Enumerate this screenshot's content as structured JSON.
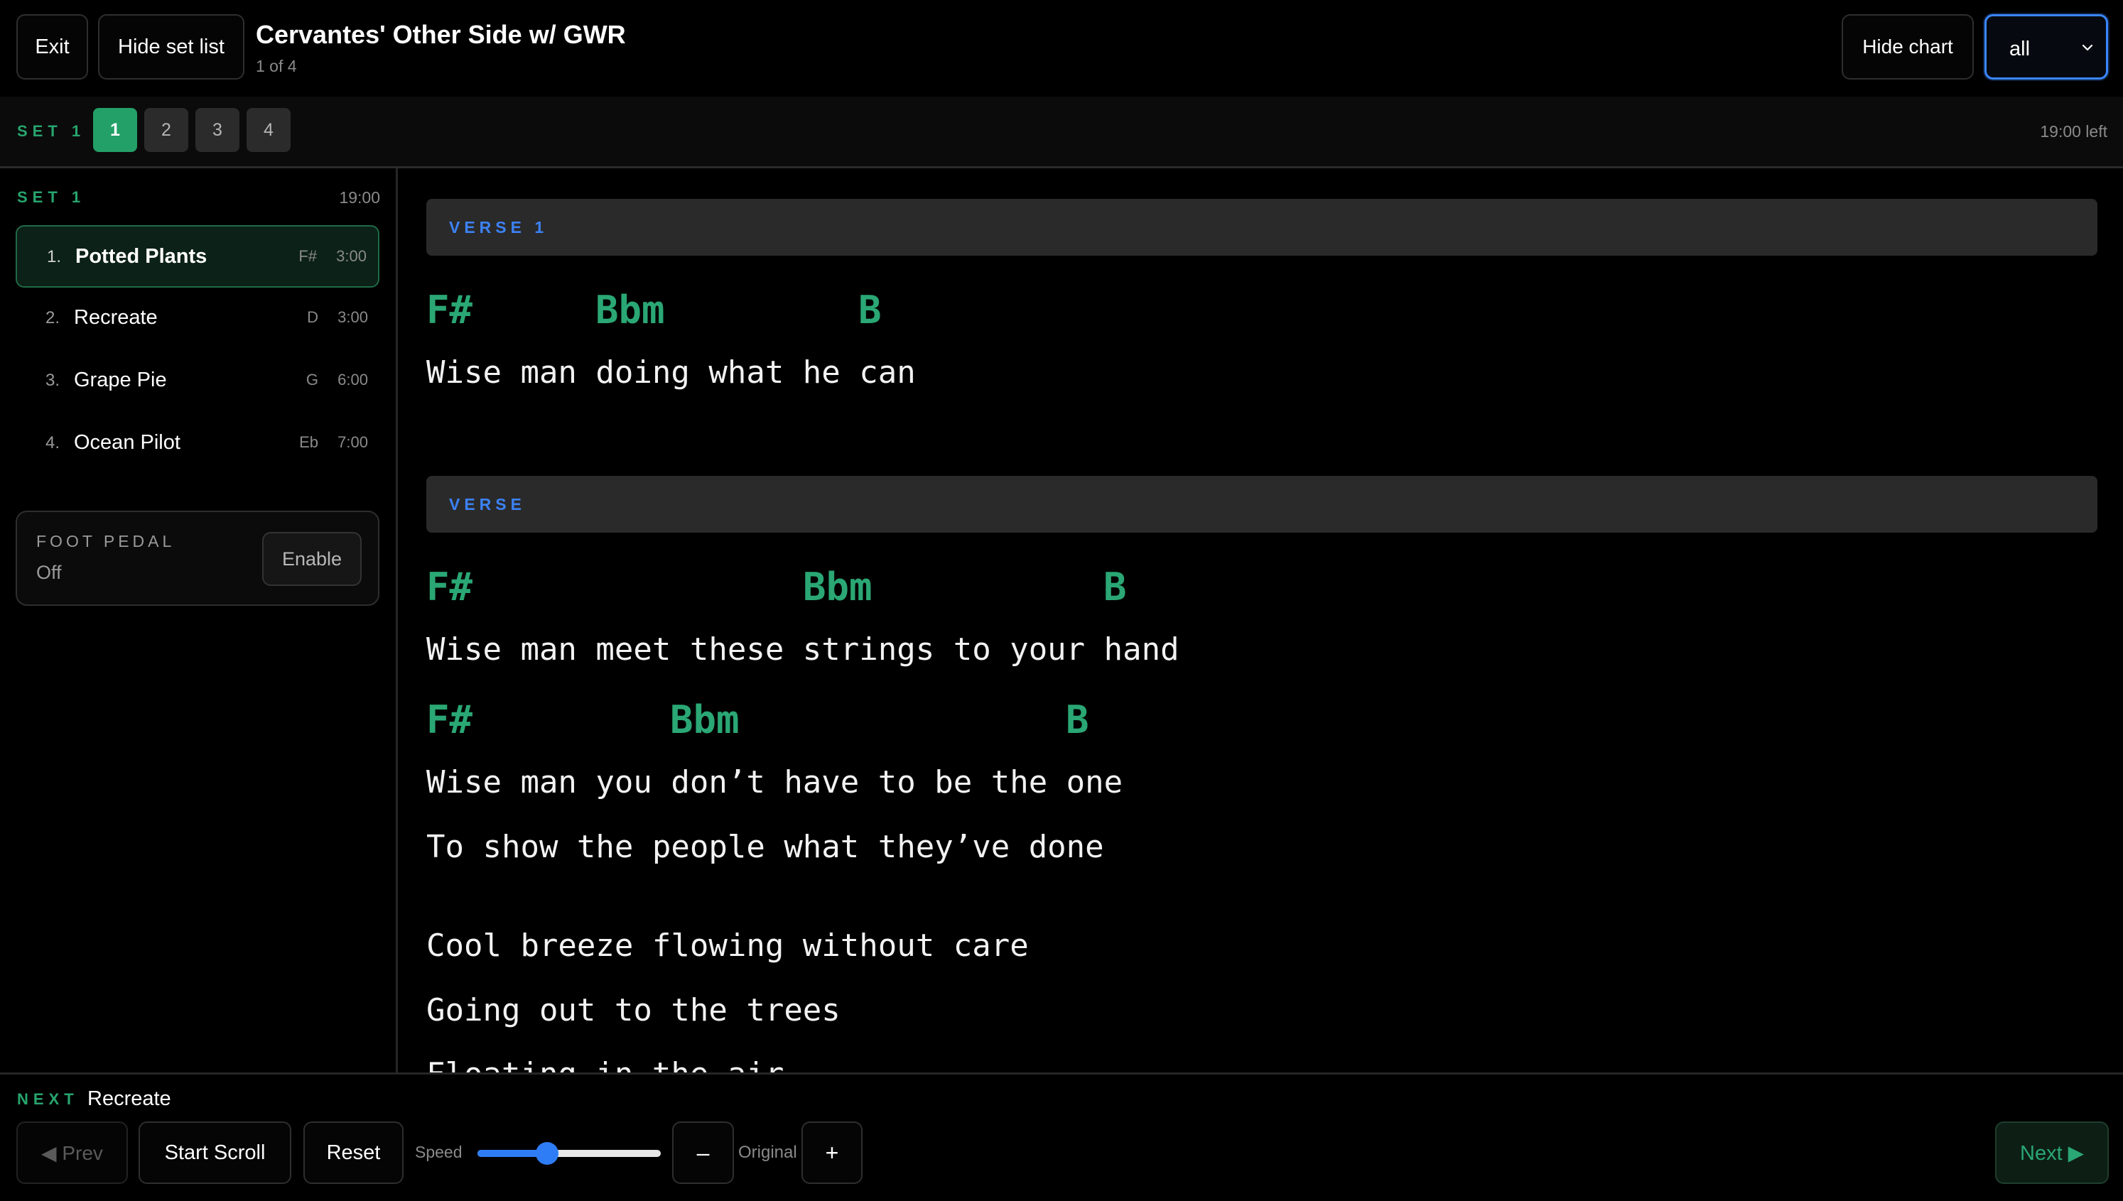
{
  "header": {
    "exit_label": "Exit",
    "hide_setlist_label": "Hide set list",
    "song_title": "Cervantes' Other Side w/ GWR",
    "song_position": "1 of 4",
    "hide_chart_label": "Hide chart",
    "section_select_value": "all"
  },
  "set_strip": {
    "label": "SET 1",
    "tabs": [
      "1",
      "2",
      "3",
      "4"
    ],
    "active_tab": "1",
    "time_left": "19:00 left"
  },
  "sidebar": {
    "set_label": "SET 1",
    "set_time": "19:00",
    "songs": [
      {
        "num": "1.",
        "name": "Potted Plants",
        "key": "F#",
        "duration": "3:00",
        "active": true
      },
      {
        "num": "2.",
        "name": "Recreate",
        "key": "D",
        "duration": "3:00",
        "active": false
      },
      {
        "num": "3.",
        "name": "Grape Pie",
        "key": "G",
        "duration": "6:00",
        "active": false
      },
      {
        "num": "4.",
        "name": "Ocean Pilot",
        "key": "Eb",
        "duration": "7:00",
        "active": false
      }
    ],
    "foot_pedal": {
      "label": "FOOT PEDAL",
      "status": "Off",
      "enable_label": "Enable"
    }
  },
  "chart": {
    "sections": [
      {
        "title": "VERSE 1"
      },
      {
        "title": "VERSE"
      }
    ],
    "chords": [
      [
        "F#",
        "Bbm",
        "B"
      ],
      [
        "F#",
        "Bbm",
        "B"
      ],
      [
        "F#",
        "Bbm",
        "B"
      ]
    ],
    "lyrics": [
      "Wise man doing what he can",
      "Wise man meet these strings to your hand",
      "Wise man you don’t have to be the one",
      "To show the people what they’ve done",
      "Cool breeze flowing without care",
      "Going out to the trees",
      "Floating in the air"
    ]
  },
  "bottom": {
    "next_label": "NEXT",
    "next_song": "Recreate",
    "prev_label": "◀ Prev",
    "start_scroll_label": "Start Scroll",
    "reset_label": "Reset",
    "speed_label": "Speed",
    "speed_value": 0.38,
    "minus_label": "–",
    "original_label": "Original",
    "plus_label": "+",
    "next_button_label": "Next ▶"
  },
  "colors": {
    "accent_green": "#23a067",
    "chord_green": "#2aa774",
    "section_blue": "#3c82f6",
    "slider_blue": "#2f7df6"
  },
  "icons": {
    "select_chevron": "chevron-down-icon"
  }
}
